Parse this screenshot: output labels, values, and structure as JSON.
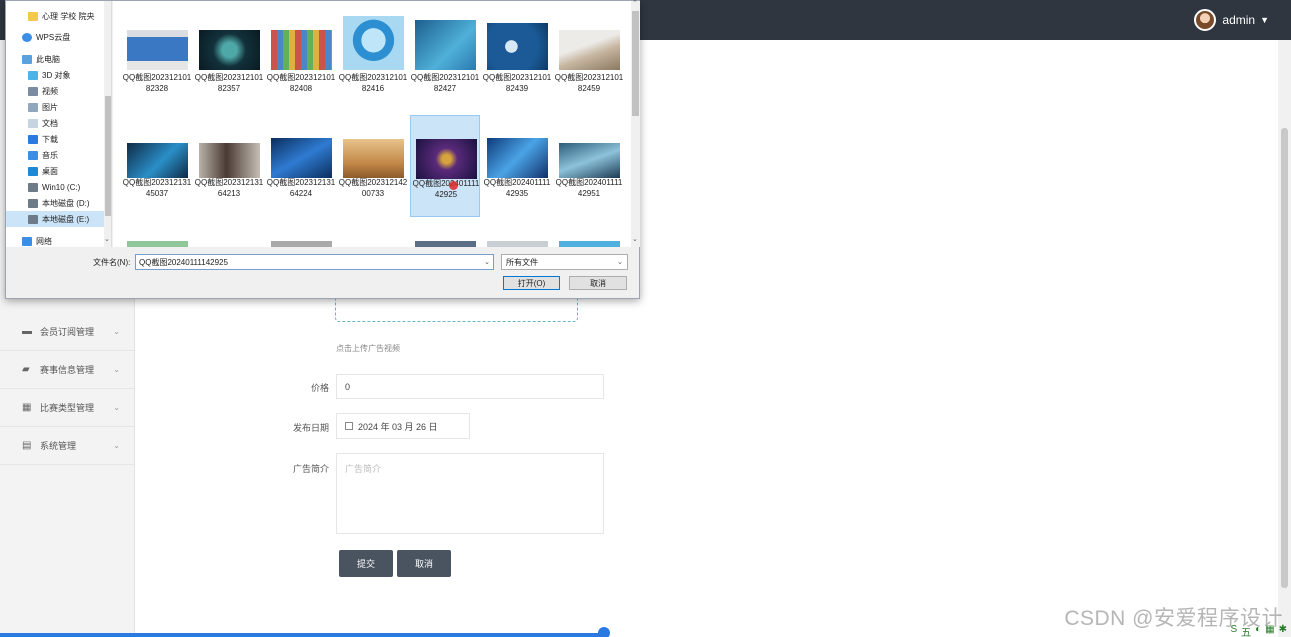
{
  "header": {
    "username": "admin"
  },
  "sidebar": {
    "items": [
      {
        "label": "会员订阅管理"
      },
      {
        "label": "赛事信息管理"
      },
      {
        "label": "比赛类型管理"
      },
      {
        "label": "系统管理"
      }
    ]
  },
  "form": {
    "upload_tip": "点击上传广告视频",
    "price_label": "价格",
    "price_value": "0",
    "date_label": "发布日期",
    "date_value": "2024 年 03 月 26 日",
    "intro_label": "广告简介",
    "intro_placeholder": "广告简介",
    "submit_label": "提交",
    "cancel_label": "取消"
  },
  "dialog": {
    "nav_items": [
      {
        "label": "心理 学校 院央",
        "icon": "folder-icon"
      },
      {
        "label": "WPS云盘",
        "icon": "cloud-icon"
      },
      {
        "label": "此电脑",
        "icon": "computer-icon"
      },
      {
        "label": "3D 对象",
        "icon": "cube-icon"
      },
      {
        "label": "视频",
        "icon": "video-icon"
      },
      {
        "label": "图片",
        "icon": "pictures-icon"
      },
      {
        "label": "文档",
        "icon": "document-icon"
      },
      {
        "label": "下载",
        "icon": "download-icon"
      },
      {
        "label": "音乐",
        "icon": "music-icon"
      },
      {
        "label": "桌面",
        "icon": "desktop-icon"
      },
      {
        "label": "Win10 (C:)",
        "icon": "drive-icon"
      },
      {
        "label": "本地磁盘 (D:)",
        "icon": "drive-icon"
      },
      {
        "label": "本地磁盘 (E:)",
        "icon": "drive-icon"
      },
      {
        "label": "网络",
        "icon": "network-icon"
      }
    ],
    "files": [
      {
        "name": "QQ截图20231210182328"
      },
      {
        "name": "QQ截图20231210182357"
      },
      {
        "name": "QQ截图20231210182408"
      },
      {
        "name": "QQ截图20231210182416"
      },
      {
        "name": "QQ截图20231210182427"
      },
      {
        "name": "QQ截图20231210182439"
      },
      {
        "name": "QQ截图20231210182459"
      },
      {
        "name": "QQ截图20231213145037"
      },
      {
        "name": "QQ截图20231213164213"
      },
      {
        "name": "QQ截图20231213164224"
      },
      {
        "name": "QQ截图20231214200733"
      },
      {
        "name": "QQ截图20240111142925"
      },
      {
        "name": "QQ截图20240111142935"
      },
      {
        "name": "QQ截图20240111142951"
      }
    ],
    "filename_label": "文件名(N):",
    "filename_value": "QQ截图20240111142925",
    "filetype_value": "所有文件",
    "open_label": "打开(O)",
    "cancel_label": "取消"
  },
  "watermark": "CSDN @安爱程序设计",
  "taskbar": {
    "ime": "五"
  }
}
